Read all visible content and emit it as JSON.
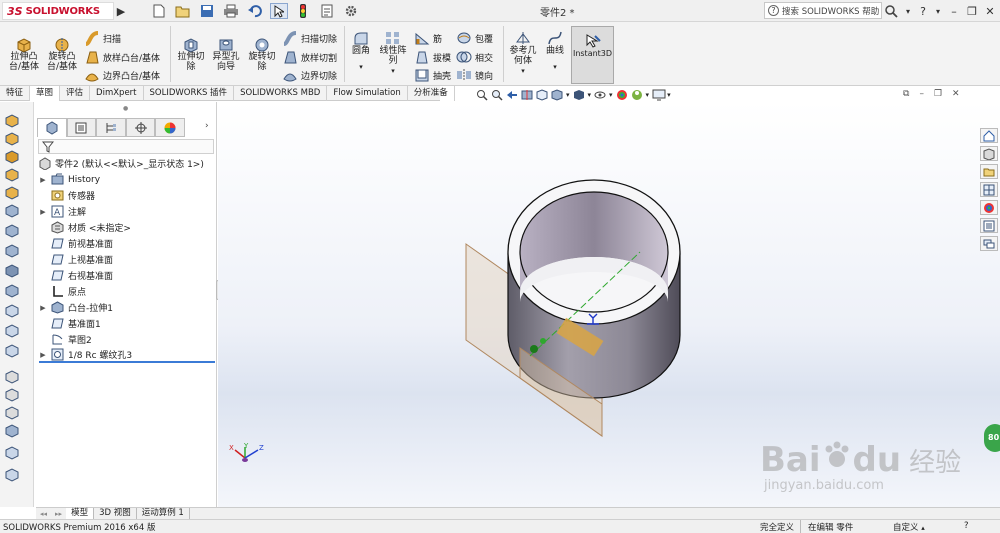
{
  "app": {
    "logo_prefix": "3S",
    "logo_text": "SOLIDWORKS",
    "document_title": "零件2 *"
  },
  "help": {
    "search_label": "搜索 SOLIDWORKS 帮助"
  },
  "ribbon": {
    "extrude_boss": "拉伸凸\n台/基体",
    "revolve_boss": "旋转凸\n台/基体",
    "sweep": "扫描",
    "loft_boss": "放样凸台/基体",
    "boundary_boss": "边界凸台/基体",
    "extrude_cut": "拉伸切\n除",
    "hole_wizard": "异型孔\n向导",
    "revolve_cut": "旋转切\n除",
    "sweep_cut": "扫描切除",
    "loft_cut": "放样切割",
    "boundary_cut": "边界切除",
    "fillet": "圆角",
    "linear_pattern": "线性阵\n列",
    "rib": "筋",
    "draft": "拔模",
    "shell": "抽壳",
    "wrap": "包覆",
    "intersect": "相交",
    "mirror": "镜向",
    "ref_geometry": "参考几\n何体",
    "curves": "曲线",
    "instant3d": "Instant3D"
  },
  "tabs": [
    "特征",
    "草图",
    "评估",
    "DimXpert",
    "SOLIDWORKS 插件",
    "SOLIDWORKS MBD",
    "Flow Simulation",
    "分析准备"
  ],
  "tree": {
    "root": "零件2 (默认<<默认>_显示状态 1>)",
    "items": [
      {
        "label": "History",
        "expand": true
      },
      {
        "label": "传感器",
        "expand": false
      },
      {
        "label": "注解",
        "expand": true
      },
      {
        "label": "材质 <未指定>",
        "expand": false
      },
      {
        "label": "前视基准面",
        "expand": false
      },
      {
        "label": "上视基准面",
        "expand": false
      },
      {
        "label": "右视基准面",
        "expand": false
      },
      {
        "label": "原点",
        "expand": false
      },
      {
        "label": "凸台-拉伸1",
        "expand": true
      },
      {
        "label": "基准面1",
        "expand": false
      },
      {
        "label": "草图2",
        "expand": false
      },
      {
        "label": "1/8 Rc 螺纹孔3",
        "expand": true
      }
    ]
  },
  "triad": {
    "x": "X",
    "y": "Y",
    "z": "Z"
  },
  "green_badge": "80",
  "bottom_tabs": [
    "模型",
    "3D 视图",
    "运动算例 1"
  ],
  "status": {
    "product": "SOLIDWORKS Premium 2016 x64 版",
    "fully_defined": "完全定义",
    "editing": "在编辑 零件",
    "custom": "自定义"
  },
  "watermark": {
    "brand": "Bai",
    "brand2": "du",
    "chinese": "经验",
    "url": "jingyan.baidu.com"
  }
}
